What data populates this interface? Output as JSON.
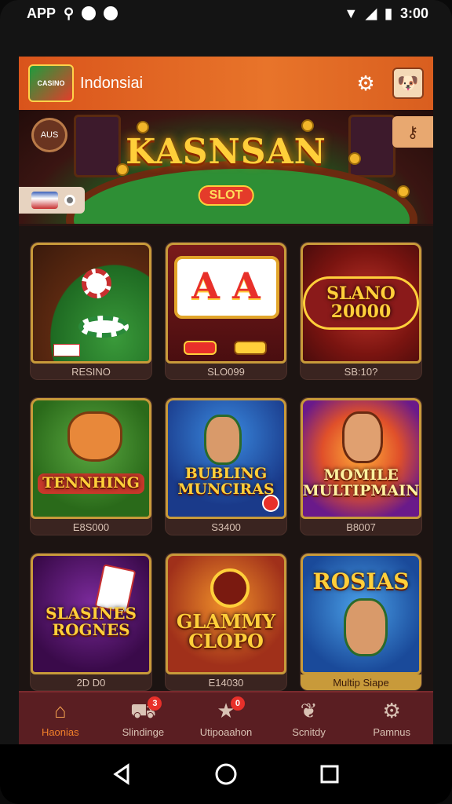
{
  "status_bar": {
    "left_text": "APP",
    "time": "3:00"
  },
  "app_bar": {
    "logo_text": "CASINO",
    "title": "Indonsiai"
  },
  "banner": {
    "title": "KASNSAN",
    "subtitle": "SLOT",
    "button_text": "AUS"
  },
  "games": [
    {
      "art_text": "",
      "label": "RESINO",
      "theme": "table",
      "has_badge": false
    },
    {
      "art_text": "A A",
      "label": "SLO099",
      "theme": "slot",
      "has_badge": true
    },
    {
      "art_text": "SLANO 20000",
      "label": "SB:10?",
      "theme": "roulette",
      "has_badge": false
    },
    {
      "art_text": "TENNHING",
      "label": "E8S000",
      "theme": "fox",
      "has_badge": false
    },
    {
      "art_text": "BUBLING MUNCIRAS",
      "label": "S3400",
      "theme": "blue",
      "has_badge": true
    },
    {
      "art_text": "MOMILE MULTIPMAIN",
      "label": "B8007",
      "theme": "purple",
      "has_badge": false
    },
    {
      "art_text": "SLASINES ROGNES",
      "label": "2D D0",
      "theme": "cards",
      "has_badge": false
    },
    {
      "art_text": "GLAMMY CLOPO",
      "label": "E14030",
      "theme": "orange",
      "has_badge": false
    },
    {
      "art_text": "ROSIAS",
      "label": "Multip Siape",
      "theme": "rosias",
      "has_badge": false
    }
  ],
  "bottom_nav": [
    {
      "label": "Haonias",
      "icon": "home-icon",
      "active": true,
      "badge": ""
    },
    {
      "label": "Slindinge",
      "icon": "cart-icon",
      "active": false,
      "badge": "3"
    },
    {
      "label": "Utipoaahon",
      "icon": "star-icon",
      "active": false,
      "badge": "0"
    },
    {
      "label": "Scnitdy",
      "icon": "leaf-icon",
      "active": false,
      "badge": ""
    },
    {
      "label": "Pamnus",
      "icon": "gear-icon",
      "active": false,
      "badge": ""
    }
  ],
  "colors": {
    "accent": "#e8742a",
    "nav_bg": "#5a1e22",
    "screen_bg": "#1c1412"
  }
}
